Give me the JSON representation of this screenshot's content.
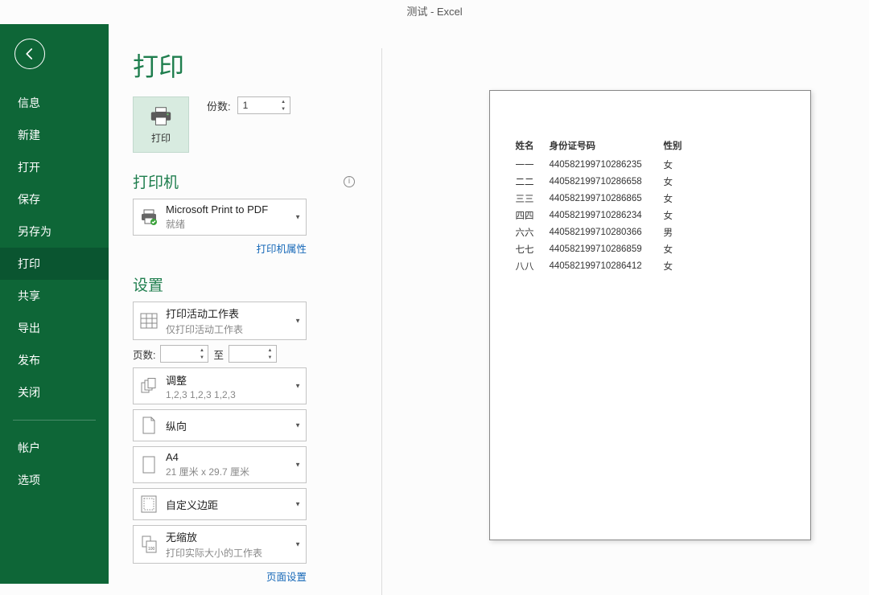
{
  "title": "测试 - Excel",
  "sidebar": {
    "items": [
      {
        "label": "信息",
        "active": false
      },
      {
        "label": "新建",
        "active": false
      },
      {
        "label": "打开",
        "active": false
      },
      {
        "label": "保存",
        "active": false
      },
      {
        "label": "另存为",
        "active": false
      },
      {
        "label": "打印",
        "active": true
      },
      {
        "label": "共享",
        "active": false
      },
      {
        "label": "导出",
        "active": false
      },
      {
        "label": "发布",
        "active": false
      },
      {
        "label": "关闭",
        "active": false
      }
    ],
    "footer": [
      {
        "label": "帐户"
      },
      {
        "label": "选项"
      }
    ]
  },
  "page": {
    "heading": "打印",
    "print_btn": "打印",
    "copies_label": "份数:",
    "copies_value": "1",
    "printer_section": "打印机",
    "printer_name": "Microsoft Print to PDF",
    "printer_status": "就绪",
    "printer_props": "打印机属性",
    "settings_section": "设置",
    "scope_line1": "打印活动工作表",
    "scope_line2": "仅打印活动工作表",
    "pages_label": "页数:",
    "pages_to": "至",
    "collate_line1": "调整",
    "collate_line2": "1,2,3    1,2,3    1,2,3",
    "orient": "纵向",
    "paper_line1": "A4",
    "paper_line2": "21 厘米 x 29.7 厘米",
    "margins": "自定义边距",
    "scale_line1": "无缩放",
    "scale_line2": "打印实际大小的工作表",
    "page_setup": "页面设置"
  },
  "preview": {
    "headers": {
      "name": "姓名",
      "id": "身份证号码",
      "sex": "性别"
    },
    "rows": [
      {
        "name": "一一",
        "id": "440582199710286235",
        "sex": "女"
      },
      {
        "name": "二二",
        "id": "440582199710286658",
        "sex": "女"
      },
      {
        "name": "三三",
        "id": "440582199710286865",
        "sex": "女"
      },
      {
        "name": "四四",
        "id": "440582199710286234",
        "sex": "女"
      },
      {
        "name": "六六",
        "id": "440582199710280366",
        "sex": "男"
      },
      {
        "name": "七七",
        "id": "440582199710286859",
        "sex": "女"
      },
      {
        "name": "八八",
        "id": "440582199710286412",
        "sex": "女"
      }
    ]
  }
}
